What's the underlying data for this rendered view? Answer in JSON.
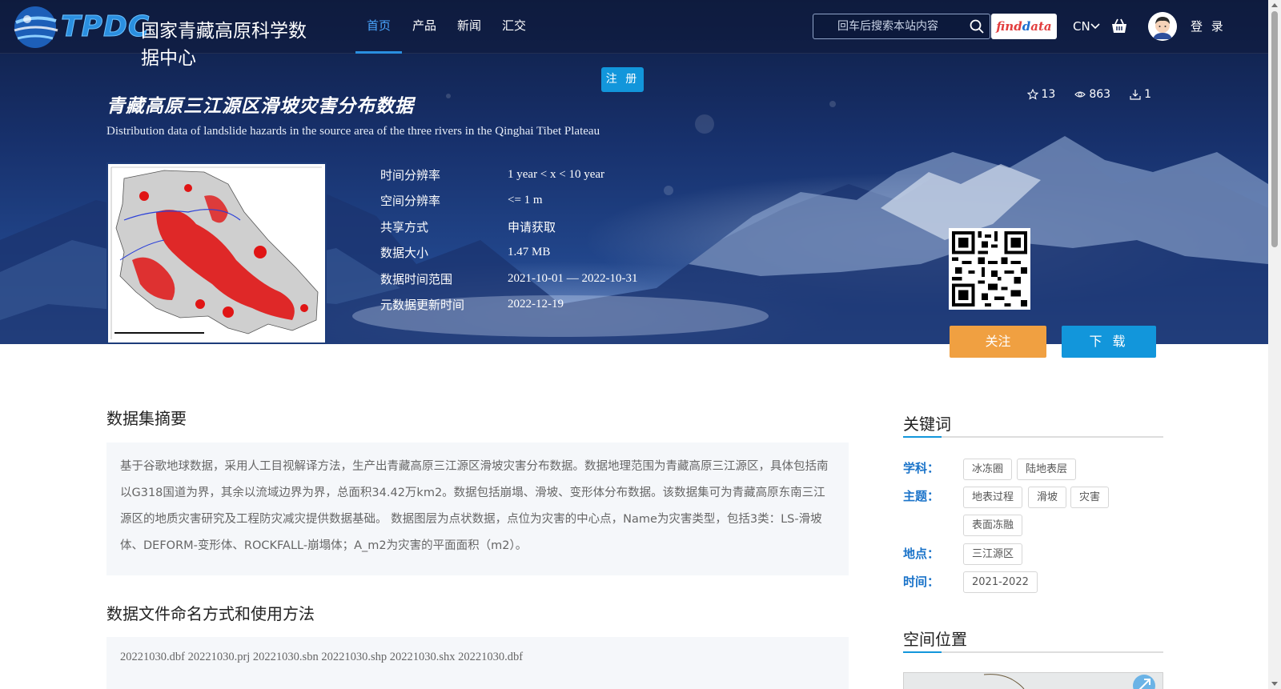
{
  "header": {
    "logo_letters": "TPDC",
    "logo_text": "国家青藏高原科学数据中心",
    "nav": [
      "首页",
      "产品",
      "新闻",
      "汇交"
    ],
    "search_placeholder": "回车后搜索本站内容",
    "findata_a": "find",
    "findata_b": "ata",
    "findata_d": "d",
    "lang": "CN",
    "login": "登 录"
  },
  "dataset": {
    "register_label": "注 册",
    "title_cn": "青藏高原三江源区滑坡灾害分布数据",
    "title_en": "Distribution data of landslide hazards in the source area of the three rivers in the Qinghai Tibet Plateau",
    "stats": {
      "favorites": "13",
      "views": "863",
      "downloads": "1"
    },
    "meta": [
      {
        "label": "时间分辨率",
        "value": "1 year < x < 10 year"
      },
      {
        "label": "空间分辨率",
        "value": "<= 1 m"
      },
      {
        "label": "共享方式",
        "value": "申请获取"
      },
      {
        "label": "数据大小",
        "value": "1.47 MB"
      },
      {
        "label": "数据时间范围",
        "value": "2021-10-01 — 2022-10-31"
      },
      {
        "label": "元数据更新时间",
        "value": "2022-12-19"
      }
    ],
    "follow_label": "关注",
    "download_label": "下 载"
  },
  "abstract": {
    "title": "数据集摘要",
    "text": "基于谷歌地球数据，采用人工目视解译方法，生产出青藏高原三江源区滑坡灾害分布数据。数据地理范围为青藏高原三江源区，具体包括南以G318国道为界，其余以流域边界为界，总面积34.42万km2。数据包括崩塌、滑坡、变形体分布数据。该数据集可为青藏高原东南三江源区的地质灾害研究及工程防灾减灾提供数据基础。 数据图层为点状数据，点位为灾害的中心点，Name为灾害类型，包括3类：LS-滑坡体、DEFORM-变形体、ROCKFALL-崩塌体；A_m2为灾害的平面面积（m2）。"
  },
  "files": {
    "title": "数据文件命名方式和使用方法",
    "text": "20221030.dbf 20221030.prj 20221030.sbn 20221030.shp 20221030.shx 20221030.dbf"
  },
  "keywords": {
    "title": "关键词",
    "subject_label": "学科：",
    "subject": [
      "冰冻圈",
      "陆地表层"
    ],
    "theme_label": "主题：",
    "theme": [
      "地表过程",
      "滑坡",
      "灾害",
      "表面冻融"
    ],
    "place_label": "地点：",
    "place": [
      "三江源区"
    ],
    "time_label": "时间：",
    "time": [
      "2021-2022"
    ]
  },
  "location": {
    "title": "空间位置"
  }
}
